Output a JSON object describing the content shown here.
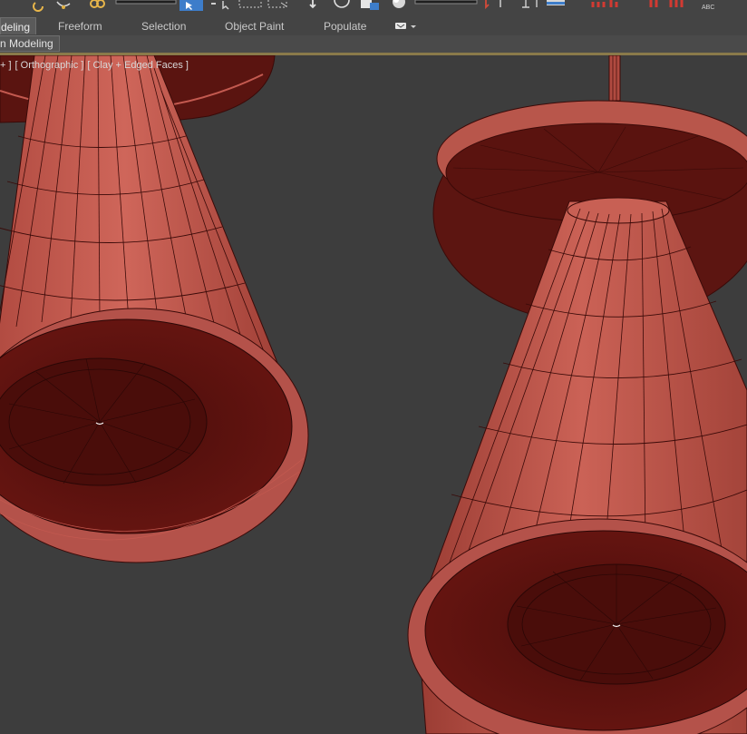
{
  "ribbon": {
    "tabs": [
      {
        "label": "deling"
      },
      {
        "label": "Freeform"
      },
      {
        "label": "Selection"
      },
      {
        "label": "Object Paint"
      },
      {
        "label": "Populate"
      }
    ],
    "panel_label": "n Modeling"
  },
  "toolbar": {
    "icons": [
      "undo-icon",
      "redo-icon",
      "link-icon",
      "unlink-icon",
      "select-object-icon",
      "select-by-name-icon",
      "rectangular-selection-icon",
      "window-crossing-icon",
      "select-and-move-icon",
      "select-and-rotate-icon",
      "select-and-scale-icon",
      "material-icon",
      "render-icon",
      "snap-toggle-icon",
      "angle-snap-icon",
      "mirror-icon",
      "align-icon",
      "spell-check-icon"
    ]
  },
  "viewport": {
    "label_plus": "+ ]",
    "label_view": "[ Orthographic ]",
    "label_shading": "[ Clay + Edged Faces ]",
    "object_color": "#c45a50",
    "wire_color": "#3a0a08"
  }
}
